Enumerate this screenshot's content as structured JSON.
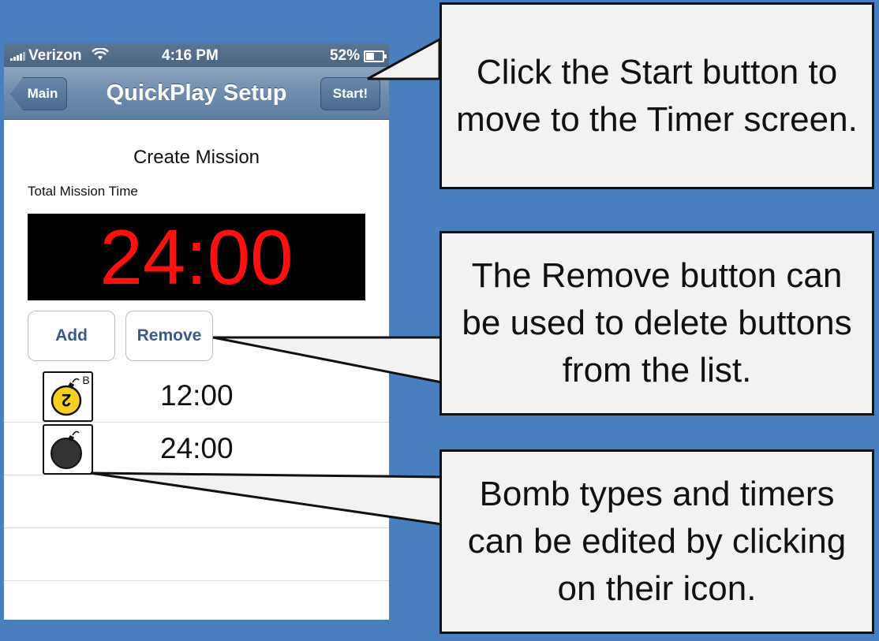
{
  "status_bar": {
    "carrier": "Verizon",
    "time": "4:16 PM",
    "battery": "52%"
  },
  "nav": {
    "back_label": "Main",
    "title": "QuickPlay Setup",
    "start_label": "Start!"
  },
  "mission": {
    "heading": "Create Mission",
    "total_label": "Total Mission Time",
    "total_time": "24:00",
    "add_label": "Add",
    "remove_label": "Remove"
  },
  "bombs": [
    {
      "icon": "yellow-bomb-2-icon",
      "badge": "B",
      "number": "2",
      "time": "12:00"
    },
    {
      "icon": "black-bomb-icon",
      "time": "24:00"
    }
  ],
  "callouts": {
    "start": "Click the Start button to move to the Timer screen.",
    "remove": "The Remove button can be used to delete buttons from the list.",
    "bomb": "Bomb types and timers can be edited by clicking on their icon."
  },
  "colors": {
    "background": "#4a7fbf",
    "navbar": "#6f8cad",
    "timer_text": "#ff1010",
    "button_text": "#3b5a8c",
    "bomb_yellow": "#f5d020"
  }
}
